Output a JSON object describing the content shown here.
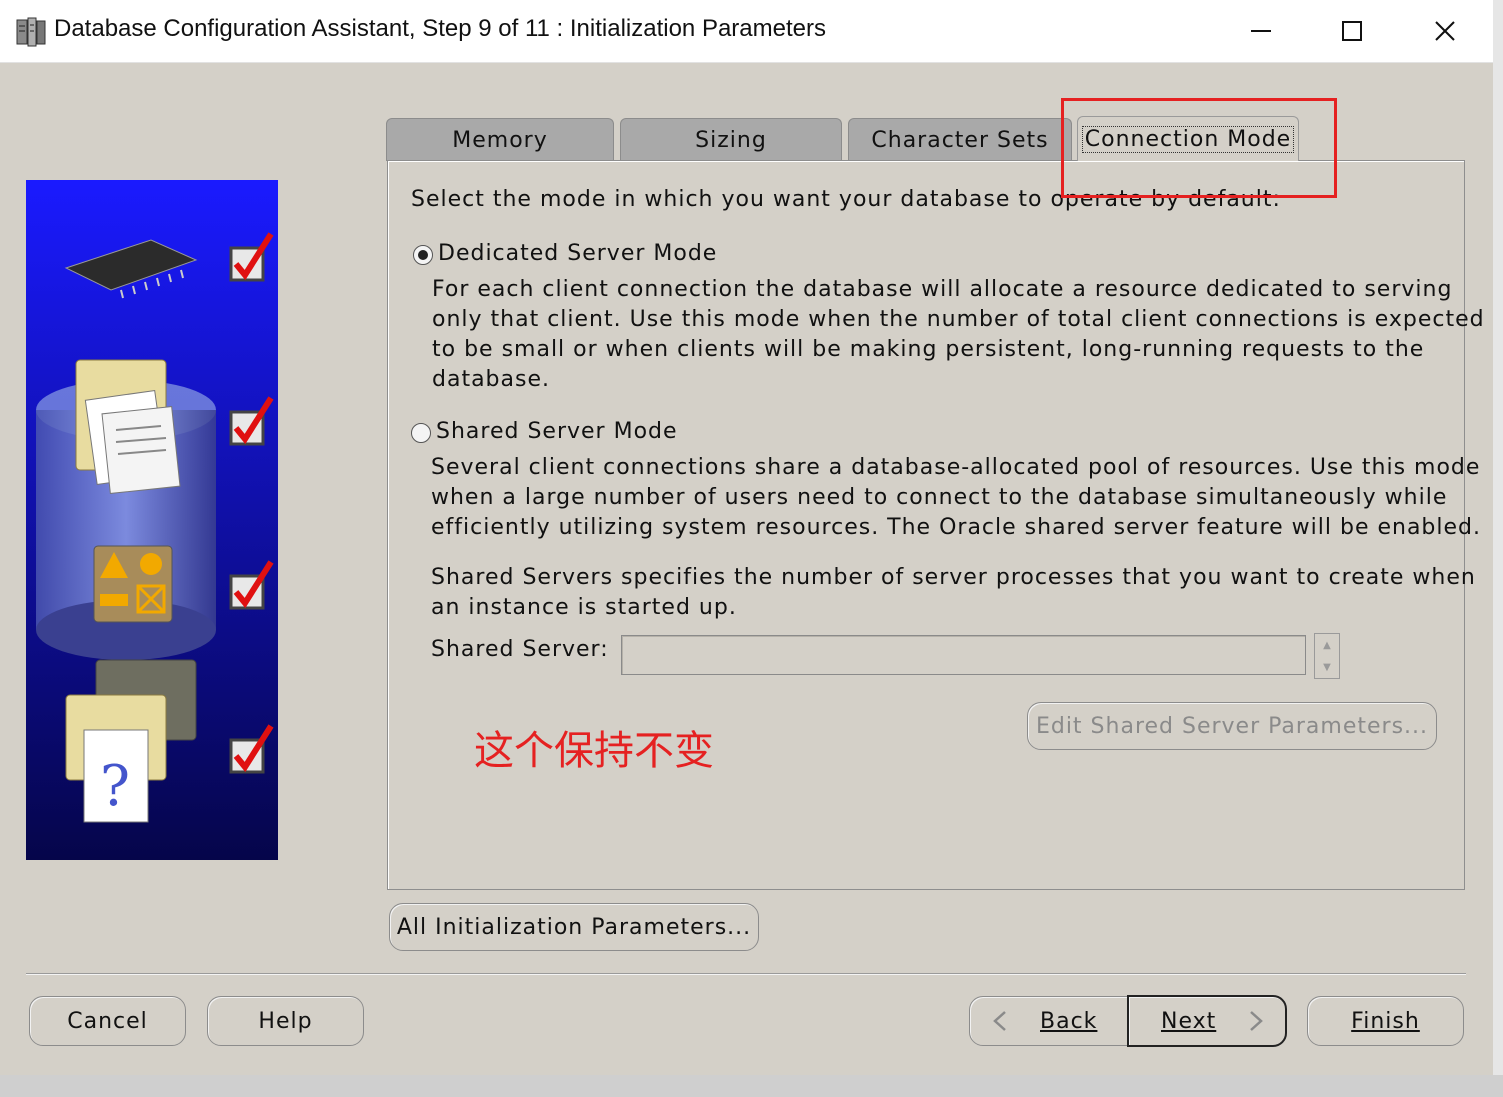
{
  "window": {
    "title": "Database Configuration Assistant, Step 9 of 11 : Initialization Parameters",
    "minimize_glyph": "—",
    "maximize_glyph": "☐",
    "close_glyph": "✕"
  },
  "tabs": [
    {
      "label": "Memory",
      "active": false
    },
    {
      "label": "Sizing",
      "active": false
    },
    {
      "label": "Character Sets",
      "active": false
    },
    {
      "label": "Connection Mode",
      "active": true
    }
  ],
  "panel": {
    "intro": "Select the mode in which you want your database to operate by default:",
    "dedicated": {
      "label": "Dedicated Server Mode",
      "selected": true,
      "description_lines": [
        "For each client connection the database will allocate a resource dedicated to serving",
        "only that client.  Use this mode when the number of total client connections is expected",
        "to be small or when clients will be making persistent, long-running requests to the",
        "database."
      ]
    },
    "shared": {
      "label": "Shared Server Mode",
      "selected": false,
      "description_lines": [
        "Several client connections share a database-allocated pool of resources.  Use this mode",
        "when a large number of users need to connect to the database simultaneously while",
        "efficiently utilizing system resources.  The Oracle shared server feature will be enabled."
      ],
      "servers_help_lines": [
        "Shared Servers specifies the number of server processes that you want to create when",
        "an instance is started up."
      ],
      "field_label": "Shared Server:",
      "field_value": "",
      "edit_button": "Edit Shared Server Parameters..."
    }
  },
  "annotation": "这个保持不变",
  "all_params_button": "All Initialization Parameters...",
  "footer": {
    "cancel": "Cancel",
    "help": "Help",
    "back": "Back",
    "next": "Next",
    "finish": "Finish"
  },
  "colors": {
    "highlight": "#e52121",
    "dialog_bg": "#d4d0c8",
    "image_blue": "#1a1ae0"
  },
  "side_steps": [
    {
      "icon": "memory-chip-icon",
      "done": true
    },
    {
      "icon": "document-folder-icon",
      "done": true
    },
    {
      "icon": "shapes-icon",
      "done": true
    },
    {
      "icon": "help-document-icon",
      "done": true
    }
  ]
}
